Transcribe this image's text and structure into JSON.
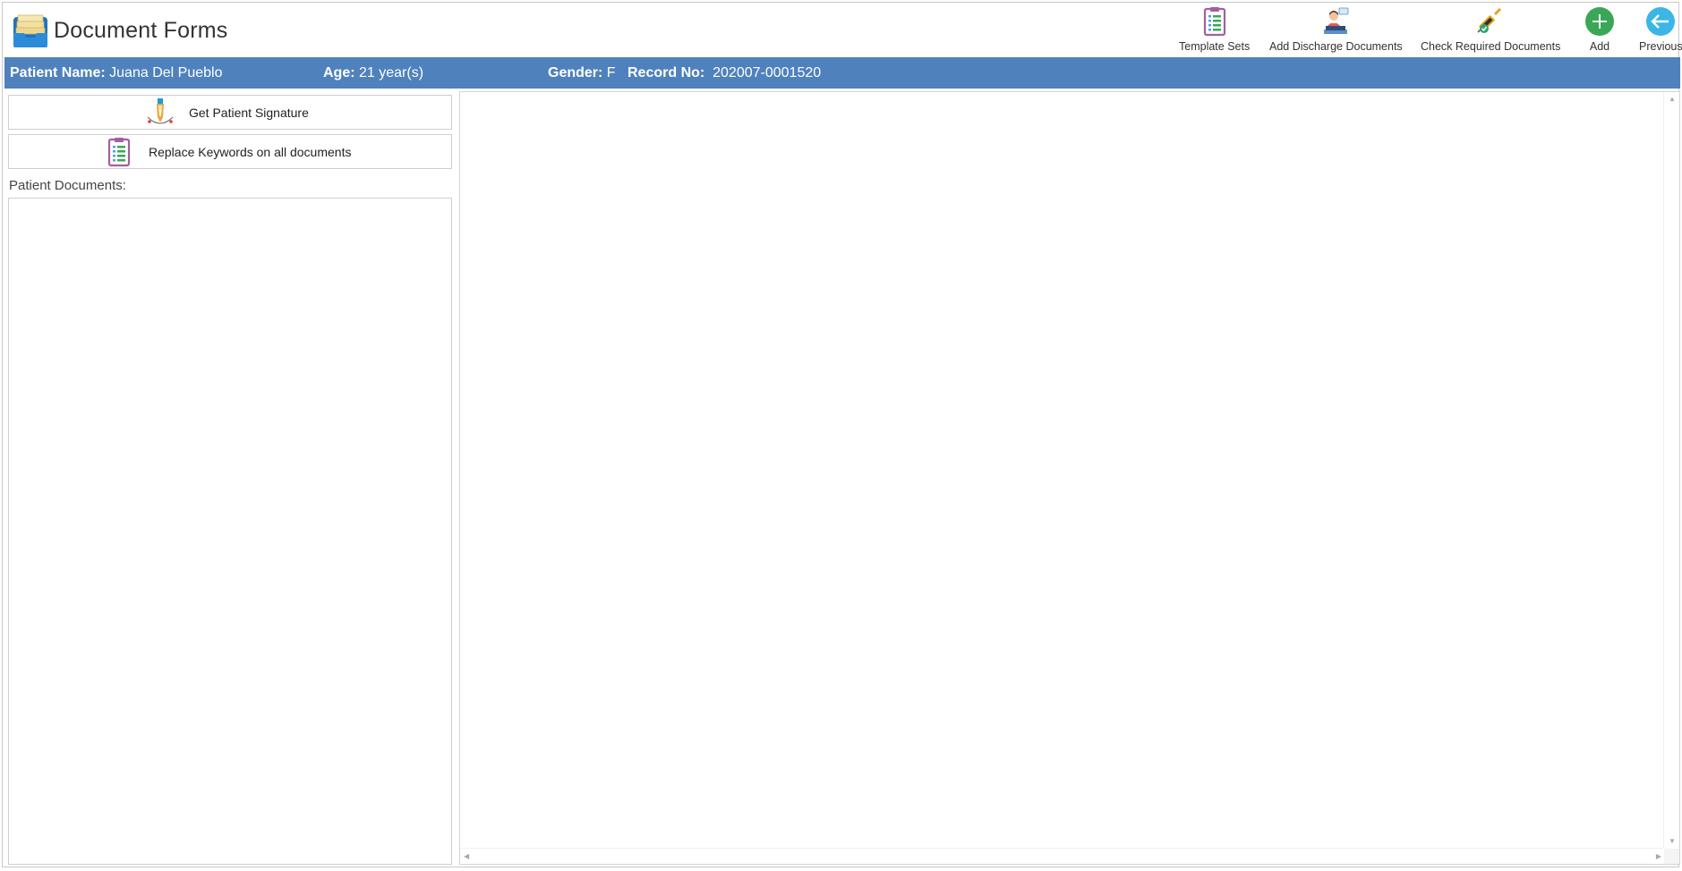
{
  "app": {
    "title": "Document Forms",
    "icon": "document-tray-icon"
  },
  "toolbar": {
    "items": [
      {
        "label": "Template Sets",
        "icon": "clipboard-list-icon"
      },
      {
        "label": "Add Discharge Documents",
        "icon": "discharge-patient-icon"
      },
      {
        "label": "Check Required Documents",
        "icon": "syringe-check-icon"
      },
      {
        "label": "Add",
        "icon": "plus-circle-icon"
      },
      {
        "label": "Previous",
        "icon": "arrow-left-circle-icon"
      }
    ]
  },
  "patient": {
    "name_label": "Patient Name:",
    "name_value": "Juana Del Pueblo",
    "age_label": "Age:",
    "age_value": "21 year(s)",
    "gender_label": "Gender:",
    "gender_value": "F",
    "record_label": "Record No:",
    "record_value": "202007-0001520"
  },
  "actions": {
    "signature_label": "Get Patient Signature",
    "replace_label": "Replace Keywords on all documents"
  },
  "documents": {
    "label": "Patient Documents:",
    "items": []
  },
  "colors": {
    "accent": "#4f81bd",
    "add_green": "#3aa757",
    "previous_teal": "#3bb6e6",
    "clipboard_purple": "#a45ea0"
  }
}
